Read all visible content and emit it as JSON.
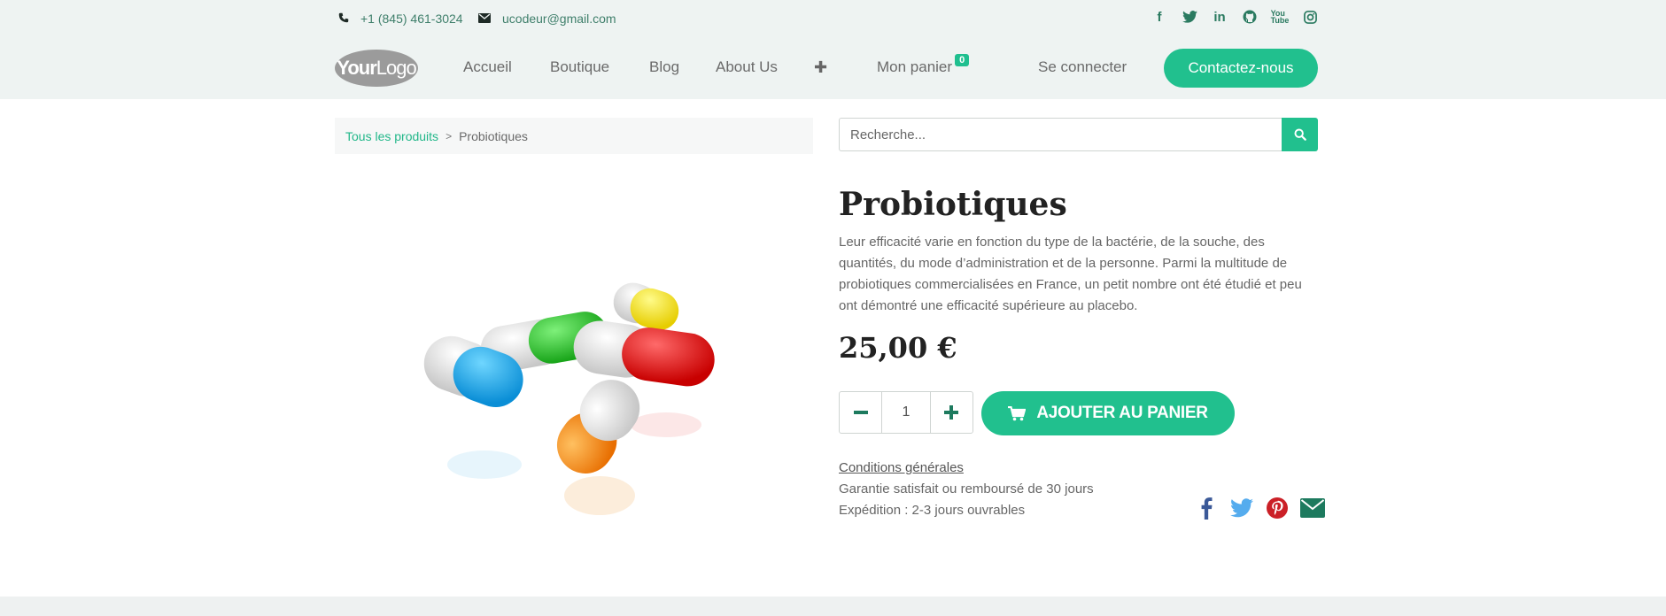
{
  "topbar": {
    "phone": "+1 (845) 461-3024",
    "email": "ucodeur@gmail.com",
    "phone_icon": "phone-icon",
    "email_icon": "envelope-icon",
    "socials": [
      "facebook-icon",
      "twitter-icon",
      "linkedin-icon",
      "github-icon",
      "youtube-icon",
      "instagram-icon"
    ]
  },
  "logo": {
    "text_bold": "Your",
    "text_light": "Logo"
  },
  "nav": {
    "items": [
      "Accueil",
      "Boutique",
      "Blog",
      "About Us"
    ],
    "more": "✚",
    "cart_label": "Mon panier",
    "cart_count": "0",
    "login": "Se connecter",
    "contact": "Contactez-nous"
  },
  "breadcrumb": {
    "link": "Tous les produits",
    "separator": ">",
    "current": "Probiotiques"
  },
  "search": {
    "placeholder": "Recherche..."
  },
  "product": {
    "name": "Probiotiques",
    "description": "Leur efficacité varie en fonction du type de la bactérie, de la souche, des quantités, du mode d’administration et de la personne. Parmi la multitude de probiotiques commercialisées en France, un petit nombre ont été étudié et peu ont démontré une efficacité supérieure au placebo.",
    "price": "25,00 €",
    "quantity": "1",
    "add_to_cart": "AJOUTER AU PANIER",
    "terms": "Conditions générales",
    "guarantee": "Garantie satisfait ou remboursé de 30 jours",
    "shipping": "Expédition : 2-3 jours ouvrables"
  },
  "colors": {
    "accent": "#21c08e",
    "header_bg": "#eef3f2",
    "facebook": "#3b5998",
    "twitter": "#55acee",
    "pinterest": "#cb2027",
    "email": "#1d7a5e"
  }
}
